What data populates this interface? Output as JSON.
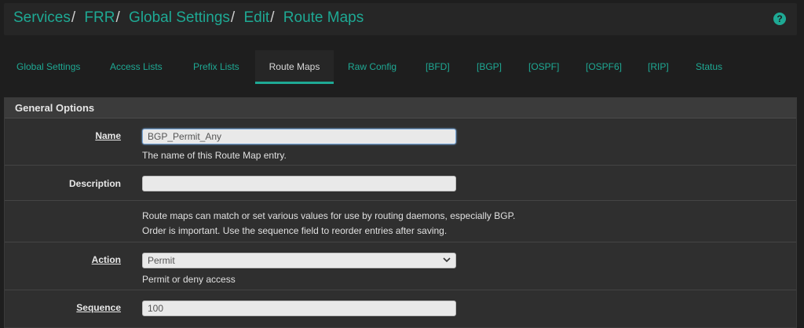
{
  "breadcrumb": {
    "items": [
      "Services",
      "FRR",
      "Global Settings",
      "Edit",
      "Route Maps"
    ],
    "separator": "/"
  },
  "help_icon": "?",
  "tabs": [
    {
      "label": "Global Settings",
      "active": false
    },
    {
      "label": "Access Lists",
      "active": false
    },
    {
      "label": "Prefix Lists",
      "active": false
    },
    {
      "label": "Route Maps",
      "active": true
    },
    {
      "label": "Raw Config",
      "active": false
    },
    {
      "label": "[BFD]",
      "active": false
    },
    {
      "label": "[BGP]",
      "active": false
    },
    {
      "label": "[OSPF]",
      "active": false
    },
    {
      "label": "[OSPF6]",
      "active": false
    },
    {
      "label": "[RIP]",
      "active": false
    },
    {
      "label": "Status",
      "active": false
    }
  ],
  "panel": {
    "title": "General Options",
    "name": {
      "label": "Name",
      "value": "BGP_Permit_Any",
      "help": "The name of this Route Map entry."
    },
    "description": {
      "label": "Description",
      "value": ""
    },
    "info": {
      "line1": "Route maps can match or set various values for use by routing daemons, especially BGP.",
      "line2": "Order is important. Use the sequence field to reorder entries after saving."
    },
    "action": {
      "label": "Action",
      "selected": "Permit",
      "help": "Permit or deny access"
    },
    "sequence": {
      "label": "Sequence",
      "value": "100"
    }
  },
  "colors": {
    "accent": "#1ea994",
    "background": "#1e1e1e",
    "panel": "#2f2f2f"
  }
}
